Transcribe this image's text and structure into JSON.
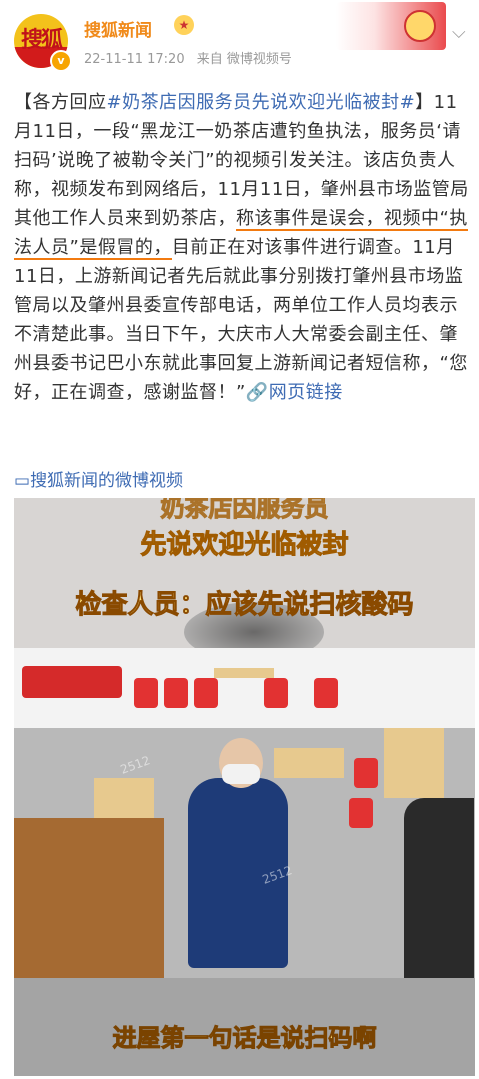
{
  "header": {
    "avatar_text": "搜狐",
    "name": "搜狐新闻",
    "timestamp": "22-11-11 17:20",
    "source": "来自 微博视频号"
  },
  "post": {
    "prefix": "【各方回应",
    "hashtag": "#奶茶店因服务员先说欢迎光临被封#",
    "suffix": "】",
    "body_1": "11月11日，一段“黑龙江一奶茶店遭钓鱼执法，服务员‘请扫码’说晚了被勒令关门”的视频引发关注。该店负责人称，视频发布到网络后，11月11日，肇州县市场监管局其他工作人员来到奶茶店，",
    "underlined": "称该事件是误会，视频中“执法人员”是假冒的，",
    "body_2": "目前正在对该事件进行调查。11月11日，上游新闻记者先后就此事分别拨打肇州县市场监管局以及肇州县委宣传部电话，两单位工作人员均表示不清楚此事。当日下午，大庆市人大常委会副主任、肇州县委书记巴小东就此事回复上游新闻记者短信称，“您好，正在调查，感谢监督！”",
    "web_link": "网页链接"
  },
  "video_link": "搜狐新闻的微博视频",
  "video": {
    "caption_top": "奶茶店因服务员",
    "caption_2": "先说欢迎光临被封",
    "caption_3": "检查人员：应该先说扫核酸码",
    "caption_bottom": "进屋第一句话是说扫码啊",
    "watermark_1": "2512",
    "watermark_2": "2512"
  },
  "colors": {
    "link": "#3e6bb3",
    "name": "#f08a1a",
    "underline": "#f27a10"
  }
}
